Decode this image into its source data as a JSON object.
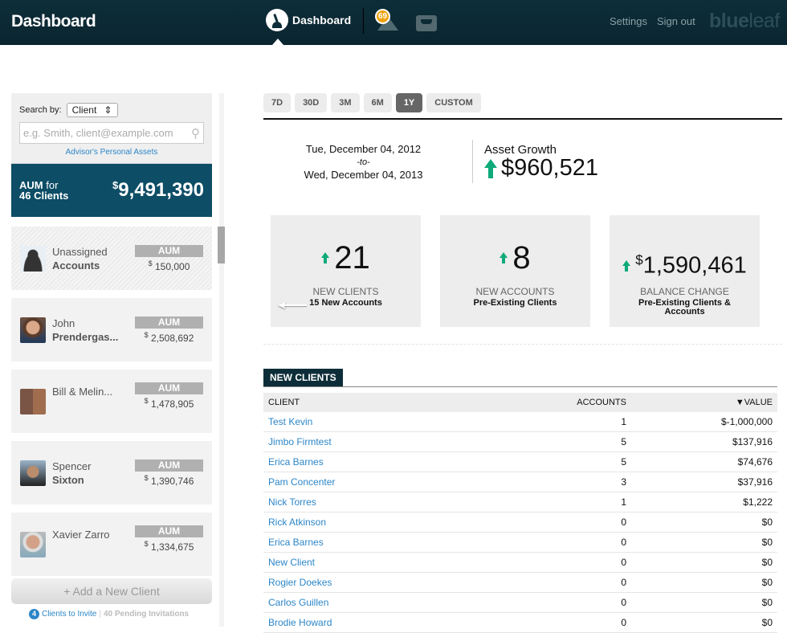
{
  "header": {
    "app_title": "Dashboard",
    "nav_dashboard": "Dashboard",
    "alerts_badge": "69",
    "settings": "Settings",
    "sign_out": "Sign out",
    "logo_bold": "blue",
    "logo_light": "leaf"
  },
  "sidebar": {
    "search_by_label": "Search by:",
    "search_by_value": "Client",
    "search_placeholder": "e.g. Smith, client@example.com",
    "advisor_link": "Advisor's Personal Assets",
    "aum_label_bold": "AUM",
    "aum_label_for": " for",
    "aum_label_clients": "46 Clients",
    "aum_currency": "$",
    "aum_total": "9,491,390",
    "clients": [
      {
        "first": "Unassigned",
        "last": "Accounts",
        "aum_label": "AUM",
        "currency": "$",
        "aum": "150,000"
      },
      {
        "first": "John",
        "last": "Prendergas...",
        "aum_label": "AUM",
        "currency": "$",
        "aum": "2,508,692"
      },
      {
        "first": "Bill & Melin...",
        "last": "",
        "aum_label": "AUM",
        "currency": "$",
        "aum": "1,478,905"
      },
      {
        "first": "Spencer",
        "last": "Sixton",
        "aum_label": "AUM",
        "currency": "$",
        "aum": "1,390,746"
      },
      {
        "first": "Xavier Zarro",
        "last": "",
        "aum_label": "AUM",
        "currency": "$",
        "aum": "1,334,675"
      }
    ],
    "add_client": "+ Add a New Client",
    "invite_count": "4",
    "invite_label": "Clients to Invite",
    "separator": "|",
    "pending": "40 Pending Invitations"
  },
  "ranges": [
    {
      "label": "7D",
      "active": false
    },
    {
      "label": "30D",
      "active": false
    },
    {
      "label": "3M",
      "active": false
    },
    {
      "label": "6M",
      "active": false
    },
    {
      "label": "1Y",
      "active": true
    },
    {
      "label": "CUSTOM",
      "active": false
    }
  ],
  "period": {
    "from": "Tue, December 04, 2012",
    "to_label": "-to-",
    "to": "Wed, December 04, 2013"
  },
  "growth": {
    "label": "Asset Growth",
    "value": "$960,521"
  },
  "stats": [
    {
      "value": "21",
      "label": "NEW CLIENTS",
      "sub": "15 New Accounts"
    },
    {
      "value": "8",
      "label": "NEW ACCOUNTS",
      "sub": "Pre-Existing Clients"
    },
    {
      "currency": "$",
      "value": "1,590,461",
      "label": "BALANCE CHANGE",
      "sub": "Pre-Existing Clients & Accounts"
    }
  ],
  "new_clients": {
    "title": "NEW CLIENTS",
    "columns": [
      "CLIENT",
      "ACCOUNTS",
      "▼VALUE"
    ],
    "rows": [
      [
        "Test Kevin",
        "1",
        "$-1,000,000"
      ],
      [
        "Jimbo Firmtest",
        "5",
        "$137,916"
      ],
      [
        "Erica Barnes",
        "5",
        "$74,676"
      ],
      [
        "Pam Concenter",
        "3",
        "$37,916"
      ],
      [
        "Nick Torres",
        "1",
        "$1,222"
      ],
      [
        "Rick Atkinson",
        "0",
        "$0"
      ],
      [
        "Erica Barnes",
        "0",
        "$0"
      ],
      [
        "New Client",
        "0",
        "$0"
      ],
      [
        "Rogier Doekes",
        "0",
        "$0"
      ],
      [
        "Carlos Guillen",
        "0",
        "$0"
      ],
      [
        "Brodie Howard",
        "0",
        "$0"
      ]
    ]
  }
}
